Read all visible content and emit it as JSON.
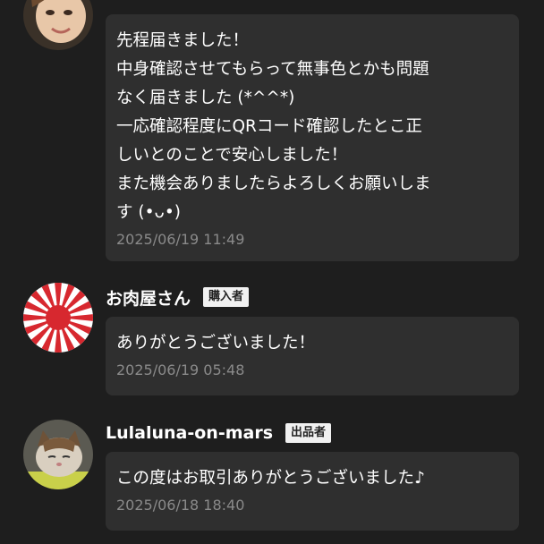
{
  "messages": [
    {
      "user_name": "",
      "role_badge": "",
      "avatar_icon": "woman-face-photo-avatar",
      "text_lines": [
        "先程届きました！",
        "中身確認させてもらって無事色とかも問題",
        "なく届きました (*^^*)",
        "一応確認程度にQRコード確認したとこ正",
        "しいとのことで安心しました！",
        "また機会ありましたらよろしくお願いしま",
        "す (•ᴗ•)"
      ],
      "timestamp": "2025/06/19 11:49"
    },
    {
      "user_name": "お肉屋さん",
      "role_badge": "購入者",
      "avatar_icon": "rising-sun-flag-avatar",
      "text_lines": [
        "ありがとうございました！"
      ],
      "timestamp": "2025/06/19 05:48"
    },
    {
      "user_name": "Lulaluna-on-mars",
      "role_badge": "出品者",
      "avatar_icon": "cat-photo-avatar",
      "text_lines": [
        "この度はお取引ありがとうございました♪"
      ],
      "timestamp": "2025/06/18 18:40"
    }
  ],
  "colors": {
    "background": "#1e1e1e",
    "bubble": "#2f2f2f",
    "timestamp": "#8a8a8a",
    "badge_bg": "#f1f1f1",
    "flag_red": "#d7282f"
  }
}
